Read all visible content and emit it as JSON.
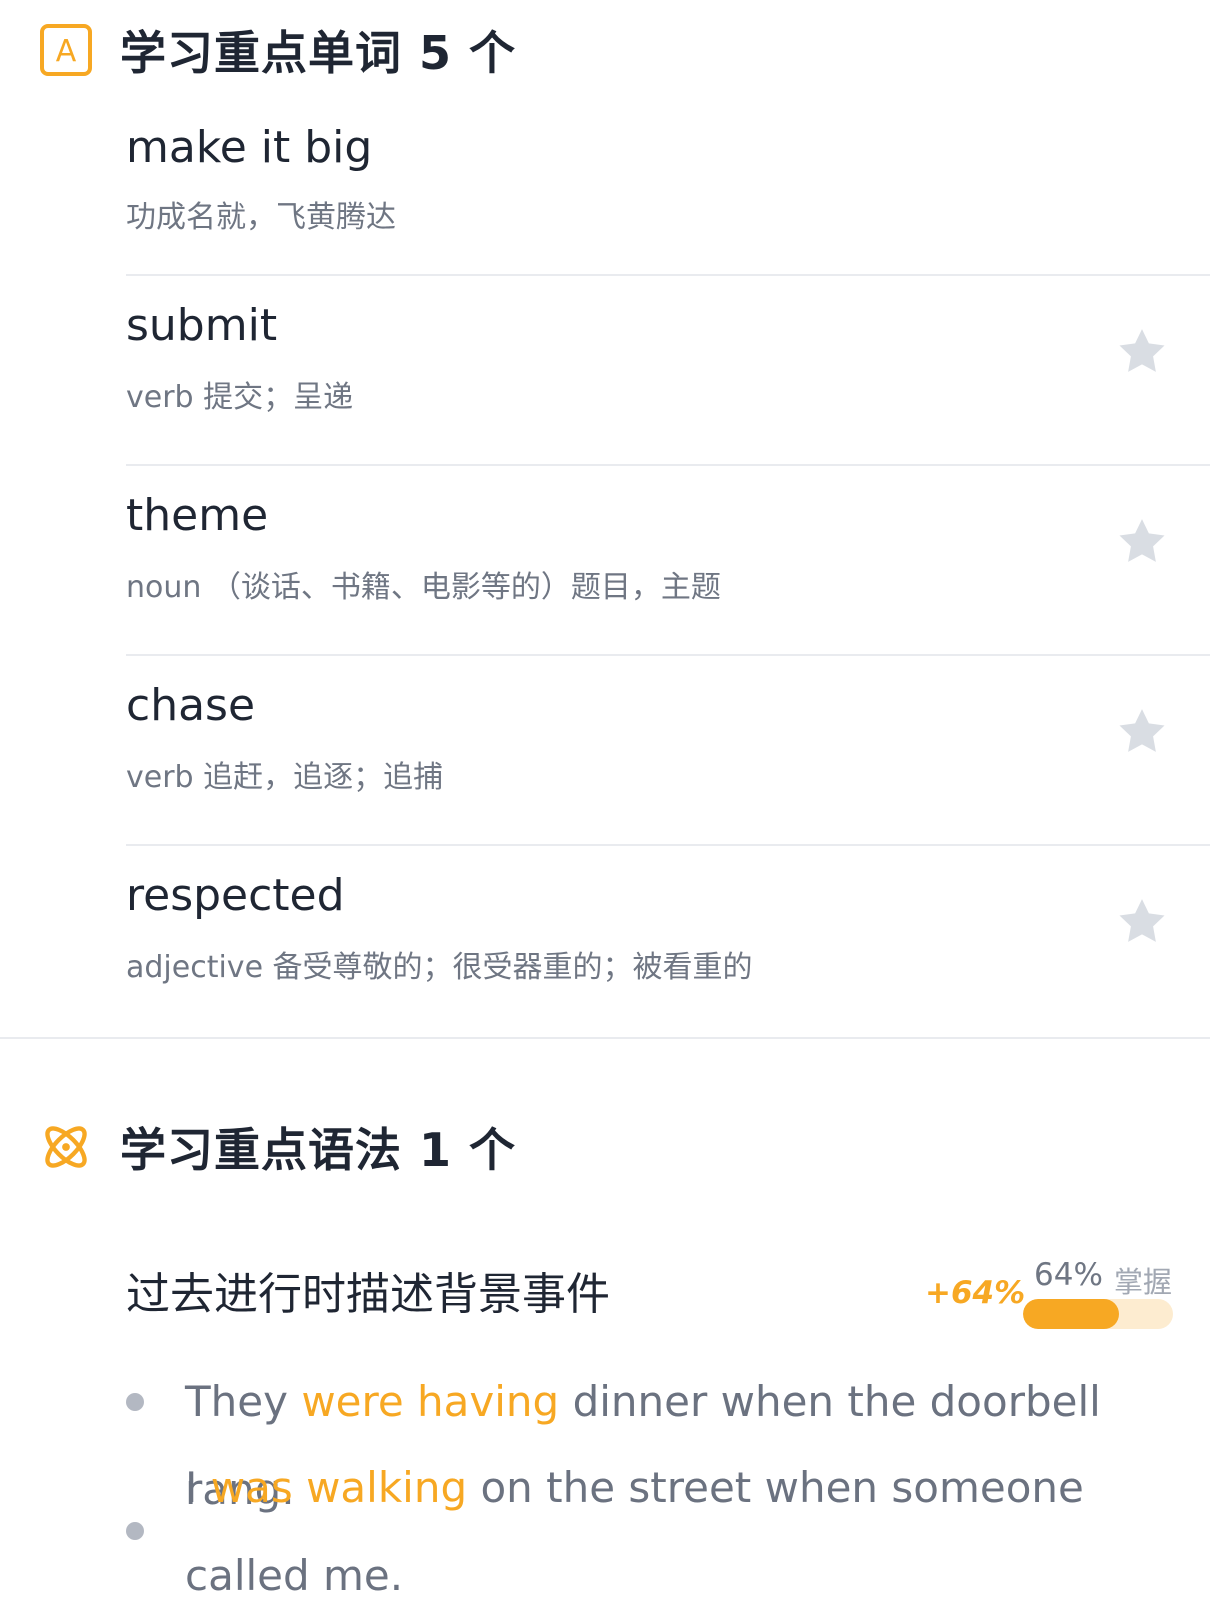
{
  "vocab_section": {
    "icon": "letter-a-icon",
    "icon_letter": "A",
    "title": "学习重点单词 5 个",
    "accent_color": "#f7a823",
    "words": [
      {
        "term": "make it big",
        "definition": "功成名就，飞黄腾达",
        "starred": null
      },
      {
        "term": "submit",
        "definition": "verb 提交；呈递",
        "starred": false
      },
      {
        "term": "theme",
        "definition": "noun （谈话、书籍、电影等的）题目，主题",
        "starred": false
      },
      {
        "term": "chase",
        "definition": "verb 追赶，追逐；追捕",
        "starred": false
      },
      {
        "term": "respected",
        "definition": "adjective 备受尊敬的；很受器重的；被看重的",
        "starred": false
      }
    ]
  },
  "grammar_section": {
    "icon": "atom-icon",
    "title": "学习重点语法 1 个",
    "points": [
      {
        "name": "过去进行时描述背景事件",
        "mastery_delta": "+64%",
        "mastery_percent": "64%",
        "mastery_label": "掌握",
        "mastery_fraction": 0.64,
        "examples": [
          {
            "pre": "They ",
            "highlight": "were having",
            "post": " dinner when the doorbell rang."
          },
          {
            "pre": "I ",
            "highlight": "was walking",
            "post": " on the street when someone called me."
          }
        ]
      }
    ]
  }
}
